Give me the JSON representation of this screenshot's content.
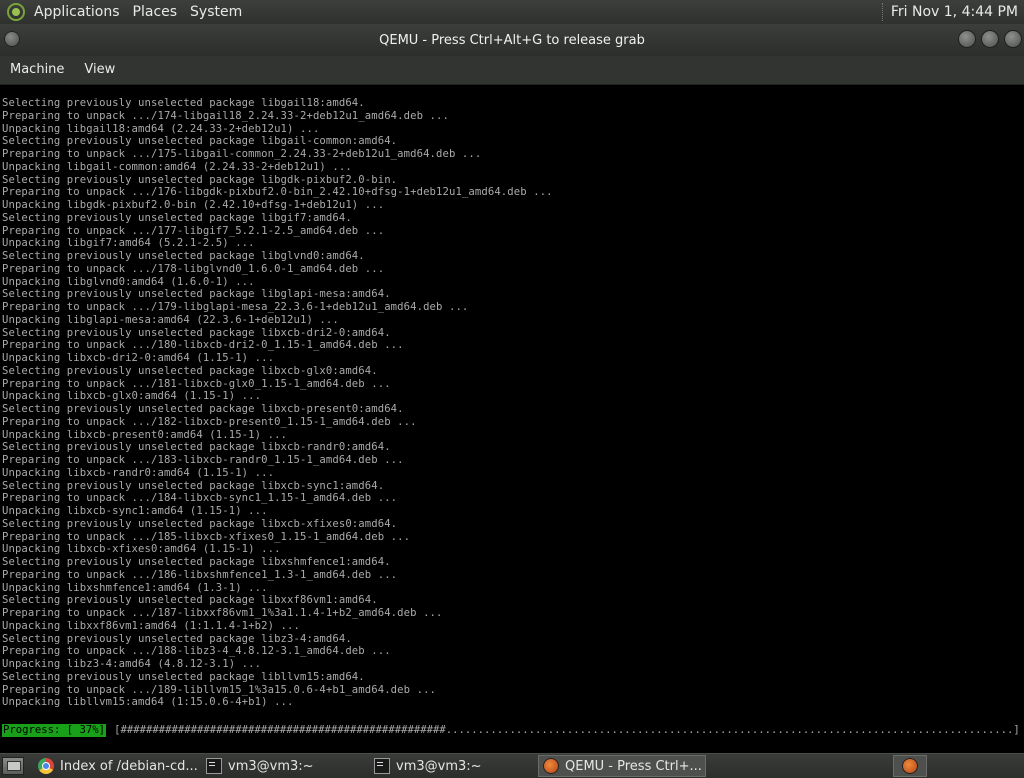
{
  "top_panel": {
    "menus": [
      "Applications",
      "Places",
      "System"
    ],
    "clock": "Fri Nov 1,  4:44 PM"
  },
  "window": {
    "title": "QEMU - Press Ctrl+Alt+G to release grab"
  },
  "menubar": {
    "items": [
      "Machine",
      "View"
    ]
  },
  "console": {
    "lines": [
      "Selecting previously unselected package libgail18:amd64.",
      "Preparing to unpack .../174-libgail18_2.24.33-2+deb12u1_amd64.deb ...",
      "Unpacking libgail18:amd64 (2.24.33-2+deb12u1) ...",
      "Selecting previously unselected package libgail-common:amd64.",
      "Preparing to unpack .../175-libgail-common_2.24.33-2+deb12u1_amd64.deb ...",
      "Unpacking libgail-common:amd64 (2.24.33-2+deb12u1) ...",
      "Selecting previously unselected package libgdk-pixbuf2.0-bin.",
      "Preparing to unpack .../176-libgdk-pixbuf2.0-bin_2.42.10+dfsg-1+deb12u1_amd64.deb ...",
      "Unpacking libgdk-pixbuf2.0-bin (2.42.10+dfsg-1+deb12u1) ...",
      "Selecting previously unselected package libgif7:amd64.",
      "Preparing to unpack .../177-libgif7_5.2.1-2.5_amd64.deb ...",
      "Unpacking libgif7:amd64 (5.2.1-2.5) ...",
      "Selecting previously unselected package libglvnd0:amd64.",
      "Preparing to unpack .../178-libglvnd0_1.6.0-1_amd64.deb ...",
      "Unpacking libglvnd0:amd64 (1.6.0-1) ...",
      "Selecting previously unselected package libglapi-mesa:amd64.",
      "Preparing to unpack .../179-libglapi-mesa_22.3.6-1+deb12u1_amd64.deb ...",
      "Unpacking libglapi-mesa:amd64 (22.3.6-1+deb12u1) ...",
      "Selecting previously unselected package libxcb-dri2-0:amd64.",
      "Preparing to unpack .../180-libxcb-dri2-0_1.15-1_amd64.deb ...",
      "Unpacking libxcb-dri2-0:amd64 (1.15-1) ...",
      "Selecting previously unselected package libxcb-glx0:amd64.",
      "Preparing to unpack .../181-libxcb-glx0_1.15-1_amd64.deb ...",
      "Unpacking libxcb-glx0:amd64 (1.15-1) ...",
      "Selecting previously unselected package libxcb-present0:amd64.",
      "Preparing to unpack .../182-libxcb-present0_1.15-1_amd64.deb ...",
      "Unpacking libxcb-present0:amd64 (1.15-1) ...",
      "Selecting previously unselected package libxcb-randr0:amd64.",
      "Preparing to unpack .../183-libxcb-randr0_1.15-1_amd64.deb ...",
      "Unpacking libxcb-randr0:amd64 (1.15-1) ...",
      "Selecting previously unselected package libxcb-sync1:amd64.",
      "Preparing to unpack .../184-libxcb-sync1_1.15-1_amd64.deb ...",
      "Unpacking libxcb-sync1:amd64 (1.15-1) ...",
      "Selecting previously unselected package libxcb-xfixes0:amd64.",
      "Preparing to unpack .../185-libxcb-xfixes0_1.15-1_amd64.deb ...",
      "Unpacking libxcb-xfixes0:amd64 (1.15-1) ...",
      "Selecting previously unselected package libxshmfence1:amd64.",
      "Preparing to unpack .../186-libxshmfence1_1.3-1_amd64.deb ...",
      "Unpacking libxshmfence1:amd64 (1.3-1) ...",
      "Selecting previously unselected package libxxf86vm1:amd64.",
      "Preparing to unpack .../187-libxxf86vm1_1%3a1.1.4-1+b2_amd64.deb ...",
      "Unpacking libxxf86vm1:amd64 (1:1.1.4-1+b2) ...",
      "Selecting previously unselected package libz3-4:amd64.",
      "Preparing to unpack .../188-libz3-4_4.8.12-3.1_amd64.deb ...",
      "Unpacking libz3-4:amd64 (4.8.12-3.1) ...",
      "Selecting previously unselected package libllvm15:amd64.",
      "Preparing to unpack .../189-libllvm15_1%3a15.0.6-4+b1_amd64.deb ...",
      "Unpacking libllvm15:amd64 (1:15.0.6-4+b1) ..."
    ],
    "progress_label": "Progress: [ 37%]",
    "progress_bar": "[###################################################.........................................................................................]"
  },
  "taskbar": {
    "tasks": [
      {
        "label": "Index of /debian-cd...",
        "icon": "chrome-icon",
        "active": false
      },
      {
        "label": "vm3@vm3:~",
        "icon": "terminal-icon",
        "active": false
      },
      {
        "label": "vm3@vm3:~",
        "icon": "terminal-icon",
        "active": false
      },
      {
        "label": "QEMU - Press Ctrl+...",
        "icon": "qemu-icon",
        "active": true
      }
    ]
  },
  "colors": {
    "progress_green": "#18a018",
    "console_text": "#aaaaaa"
  }
}
